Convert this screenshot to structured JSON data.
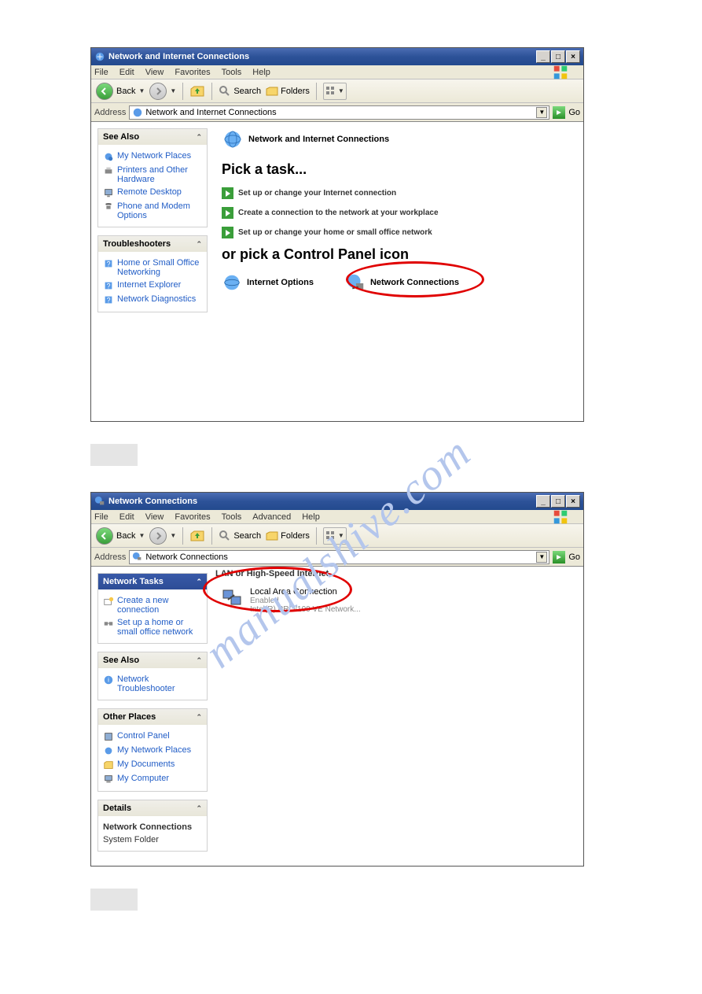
{
  "watermark": "manualshive.com",
  "win1": {
    "title": "Network and Internet Connections",
    "menu": [
      "File",
      "Edit",
      "View",
      "Favorites",
      "Tools",
      "Help"
    ],
    "toolbar": {
      "back": "Back",
      "search": "Search",
      "folders": "Folders"
    },
    "address_label": "Address",
    "address_value": "Network and Internet Connections",
    "go": "Go",
    "sidebar": {
      "see_also": {
        "title": "See Also",
        "items": [
          "My Network Places",
          "Printers and Other Hardware",
          "Remote Desktop",
          "Phone and Modem Options"
        ]
      },
      "trouble": {
        "title": "Troubleshooters",
        "items": [
          "Home or Small Office Networking",
          "Internet Explorer",
          "Network Diagnostics"
        ]
      }
    },
    "main": {
      "header": "Network and Internet Connections",
      "pick_task": "Pick a task...",
      "tasks": [
        "Set up or change your Internet connection",
        "Create a connection to the network at your workplace",
        "Set up or change your home or small office network"
      ],
      "pick_icon": "or pick a Control Panel icon",
      "icons": [
        "Internet Options",
        "Network Connections"
      ]
    }
  },
  "win2": {
    "title": "Network Connections",
    "menu": [
      "File",
      "Edit",
      "View",
      "Favorites",
      "Tools",
      "Advanced",
      "Help"
    ],
    "toolbar": {
      "back": "Back",
      "search": "Search",
      "folders": "Folders"
    },
    "address_label": "Address",
    "address_value": "Network Connections",
    "go": "Go",
    "sidebar": {
      "nettasks": {
        "title": "Network Tasks",
        "items": [
          "Create a new connection",
          "Set up a home or small office network"
        ]
      },
      "see_also": {
        "title": "See Also",
        "items": [
          "Network Troubleshooter"
        ]
      },
      "other": {
        "title": "Other Places",
        "items": [
          "Control Panel",
          "My Network Places",
          "My Documents",
          "My Computer"
        ]
      },
      "details": {
        "title": "Details",
        "name": "Network Connections",
        "type": "System Folder"
      }
    },
    "main": {
      "section": "LAN or High-Speed Internet",
      "conn": {
        "name": "Local Area Connection",
        "status": "Enabled",
        "device": "Intel(R) PRO/100 VE Network..."
      }
    }
  },
  "step1": " ",
  "step2": " "
}
